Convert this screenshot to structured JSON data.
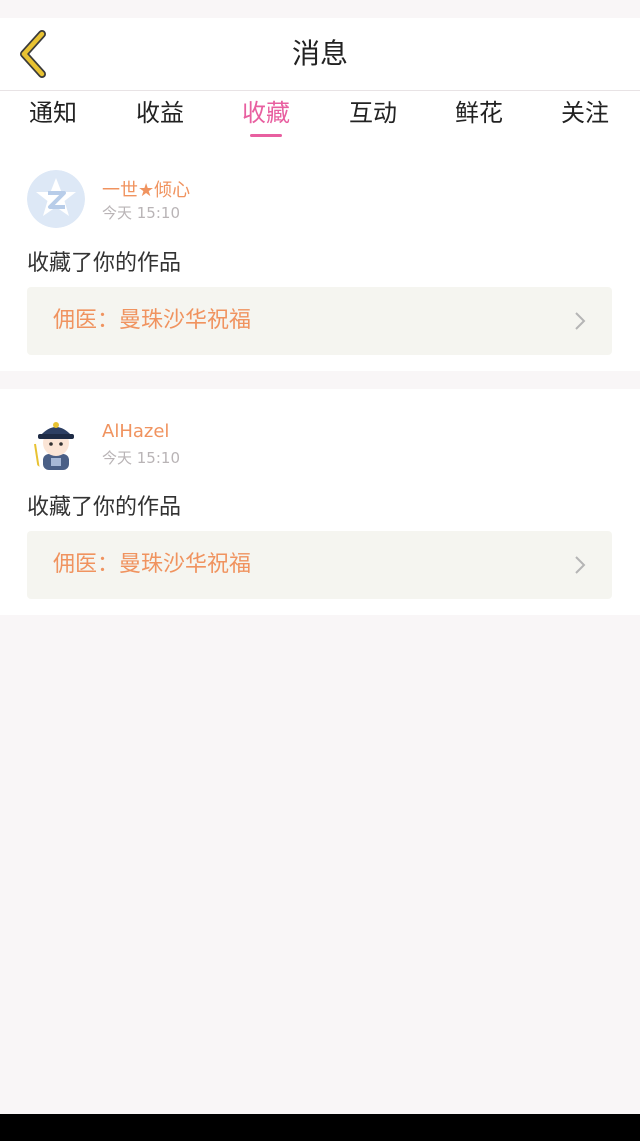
{
  "header": {
    "title": "消息",
    "back_icon": "chevron-left-icon"
  },
  "tabs": [
    {
      "label": "通知",
      "active": false
    },
    {
      "label": "收益",
      "active": false
    },
    {
      "label": "收藏",
      "active": true
    },
    {
      "label": "互动",
      "active": false
    },
    {
      "label": "鲜花",
      "active": false
    },
    {
      "label": "关注",
      "active": false
    }
  ],
  "colors": {
    "accent": "#e85fa0",
    "username": "#f0935f",
    "back_icon": "#e8c232",
    "page_bg": "#f9f6f7"
  },
  "messages": [
    {
      "username": "一世★倾心",
      "time": "今天 15:10",
      "action": "收藏了你的作品",
      "work_title": "佣医：曼珠沙华祝福",
      "avatar_icon": "qq-zone-avatar-icon"
    },
    {
      "username": "AlHazel",
      "time": "今天 15:10",
      "action": "收藏了你的作品",
      "work_title": "佣医：曼珠沙华祝福",
      "avatar_icon": "cartoon-official-avatar-icon"
    }
  ]
}
